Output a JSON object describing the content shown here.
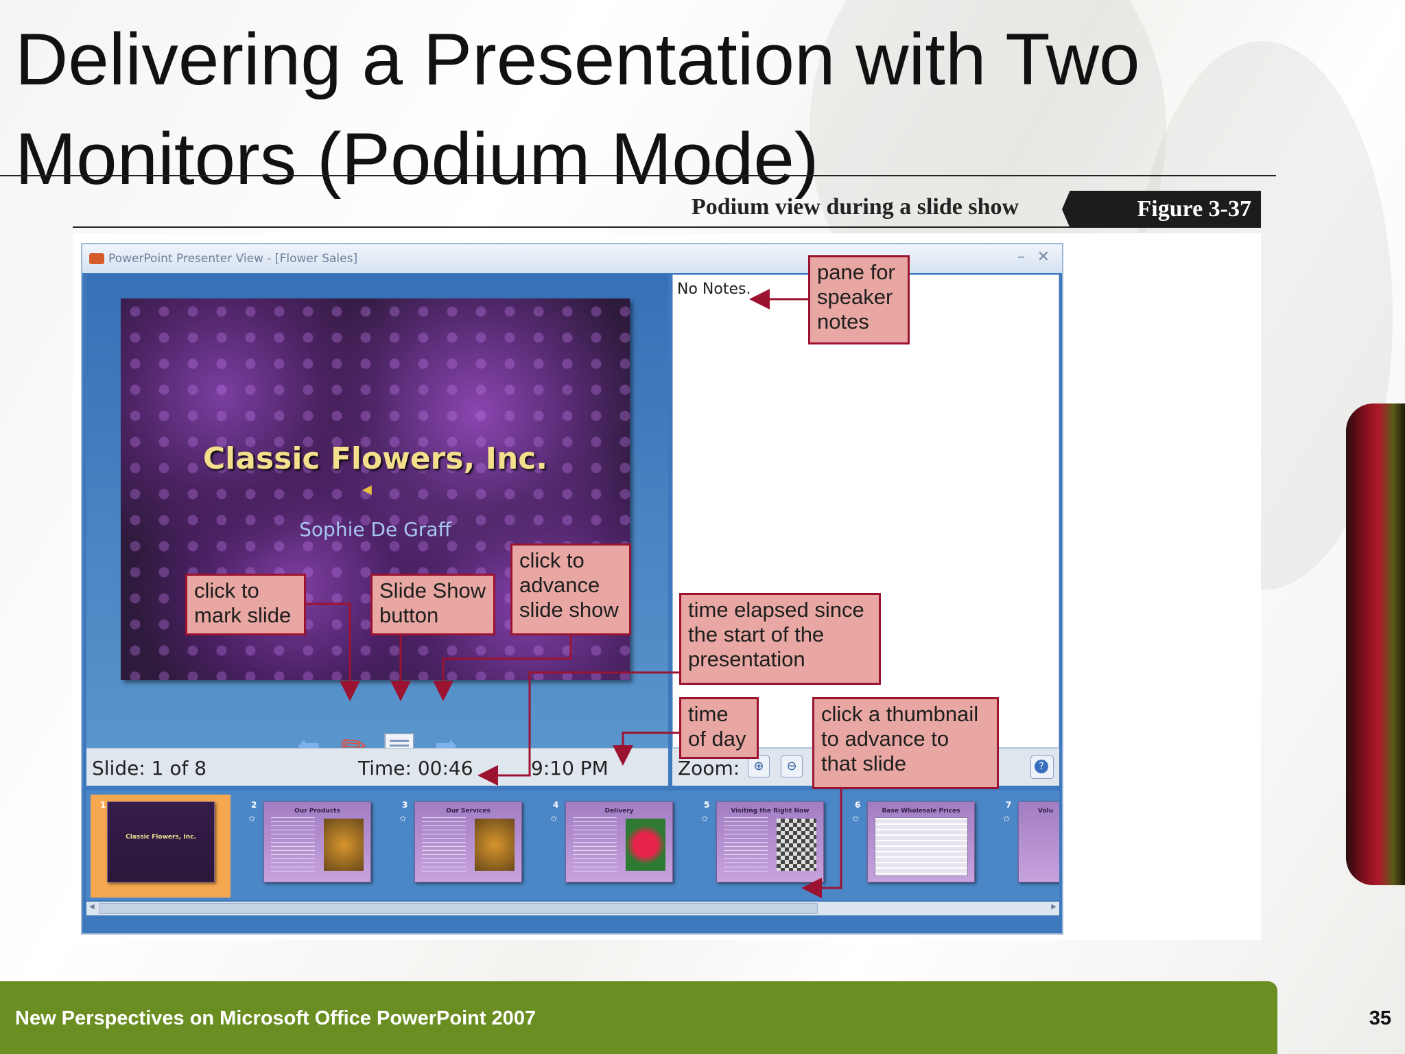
{
  "slide": {
    "title": "Delivering a Presentation with Two Monitors (Podium Mode)",
    "page_number": "35",
    "footer": "New Perspectives on Microsoft Office PowerPoint 2007"
  },
  "figure": {
    "caption": "Podium view during a slide show",
    "label": "Figure  3-37"
  },
  "window": {
    "title": "PowerPoint Presenter View - [Flower Sales]",
    "minimize": "–",
    "close": "✕",
    "current_slide": {
      "title": "Classic Flowers, Inc.",
      "subtitle": "Sophie De Graff"
    },
    "notes": "No Notes.",
    "status": {
      "slide": "Slide: 1 of 8",
      "time": "Time: 00:46",
      "clock": "9:10 PM",
      "zoom_label": "Zoom:",
      "zoom_in": "⊕",
      "zoom_out": "⊖",
      "help": "?"
    },
    "thumbnails": [
      {
        "num": "1",
        "title": "Classic Flowers, Inc."
      },
      {
        "num": "2",
        "title": "Our Products"
      },
      {
        "num": "3",
        "title": "Our Services"
      },
      {
        "num": "4",
        "title": "Delivery"
      },
      {
        "num": "5",
        "title": "Visiting the Right Now"
      },
      {
        "num": "6",
        "title": "Base Wholesale Prices"
      },
      {
        "num": "7",
        "title": "Volu"
      }
    ]
  },
  "callouts": {
    "notes_pane": "pane for\nspeaker\nnotes",
    "mark_slide": "click to\nmark slide",
    "show_button": "Slide Show\nbutton",
    "advance": "click to\nadvance\nslide show",
    "elapsed": "time elapsed since\nthe start of the\npresentation",
    "time_of_day": "time\nof day",
    "thumbnail": "click a thumbnail\nto advance to\nthat slide"
  },
  "colors": {
    "footer_bar": "#6b8e23",
    "callout_fill": "#e8a7a2",
    "callout_border": "#9b1330",
    "window_blue": "#3f79bd"
  },
  "icons": {
    "prev": "left-arrow-icon",
    "pen": "pen-icon",
    "show": "slide-show-icon",
    "next": "right-arrow-icon"
  }
}
